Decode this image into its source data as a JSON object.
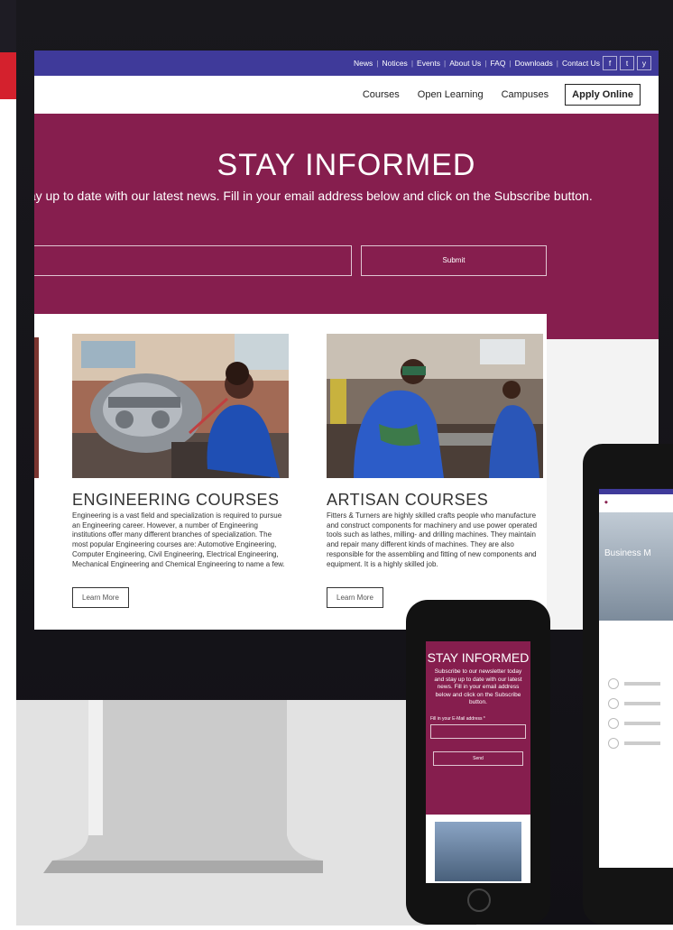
{
  "top_nav": {
    "links": [
      "News",
      "Notices",
      "Events",
      "About Us",
      "FAQ",
      "Downloads",
      "Contact Us"
    ],
    "social": [
      "f",
      "t",
      "y"
    ]
  },
  "main_nav": {
    "links": [
      "Courses",
      "Open Learning",
      "Campuses"
    ],
    "apply": "Apply Online"
  },
  "hero": {
    "title": "STAY INFORMED",
    "text": "d stay up to date with our latest news. Fill in your email address below and click on the Subscribe button.",
    "submit": "Submit"
  },
  "cards": [
    {
      "title": "ENGINEERING COURSES",
      "text": "Engineering is a vast field and specialization is required to pursue an Engineering career. However, a number of Engineering institutions offer many different branches of specialization. The most popular Engineering courses are: Automotive Engineering, Computer Engineering, Civil Engineering, Electrical Engineering, Mechanical Engineering and Chemical Engineering to name a few.",
      "button": "Learn More"
    },
    {
      "title": "ARTISAN COURSES",
      "text": "Fitters & Turners are highly skilled crafts people who manufacture and construct components for machinery and use power operated tools such as lathes, milling- and drilling machines. They maintain and repair many different kinds of machines. They are also responsible for the assembling and fitting of new components and equipment. It is a highly skilled job.",
      "button": "Learn More"
    }
  ],
  "phone": {
    "title": "STAY INFORMED",
    "text": "Subscribe to our newsletter today and stay up to date with our latest news. Fill in your email address below and click on the Subscribe button.",
    "label": "Fill in your E-Mail address *",
    "send": "Send"
  },
  "tablet": {
    "hero_text": "Business M"
  }
}
